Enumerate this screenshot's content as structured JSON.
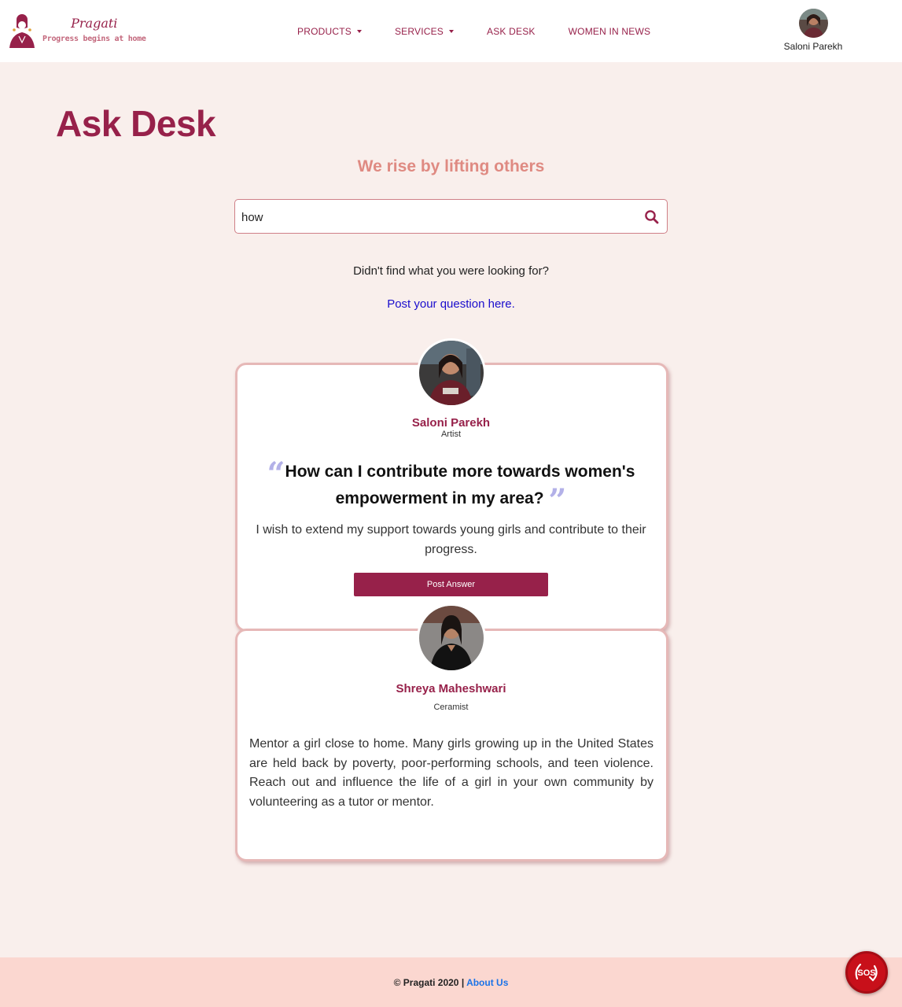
{
  "brand": {
    "name": "Pragati",
    "tagline": "Progress begins at home",
    "logo_icon": "woman-silhouette-icon",
    "accent_color": "#97214a"
  },
  "nav": {
    "items": [
      {
        "label": "PRODUCTS",
        "dropdown": true
      },
      {
        "label": "SERVICES",
        "dropdown": true
      },
      {
        "label": "ASK DESK",
        "dropdown": false
      },
      {
        "label": "WOMEN IN NEWS",
        "dropdown": false
      }
    ],
    "profile_name": "Saloni Parekh"
  },
  "page": {
    "title": "Ask Desk",
    "subtitle": "We rise by lifting others",
    "search": {
      "value": "how",
      "placeholder": "",
      "icon": "search-icon"
    },
    "not_found_text": "Didn't find what you were looking for?",
    "post_question_link": "Post your question here."
  },
  "question_card": {
    "author_name": "Saloni Parekh",
    "author_role": "Artist",
    "question": "How can I contribute more towards women's empowerment in my area?",
    "description": "I wish to extend my support towards young girls and contribute to their progress.",
    "button_label": "Post Answer",
    "open_quote": "“",
    "close_quote": "”"
  },
  "answer_card": {
    "author_name": "Shreya Maheshwari",
    "author_role": "Ceramist",
    "answer": "Mentor a girl close to home. Many girls growing up in the United States are held back by poverty, poor-performing schools, and teen violence. Reach out and influence the life of a girl in your own community by volunteering as a tutor or mentor."
  },
  "footer": {
    "copyright": "© Pragati 2020 |",
    "about_link": "About Us",
    "sos_label": "SOS"
  }
}
